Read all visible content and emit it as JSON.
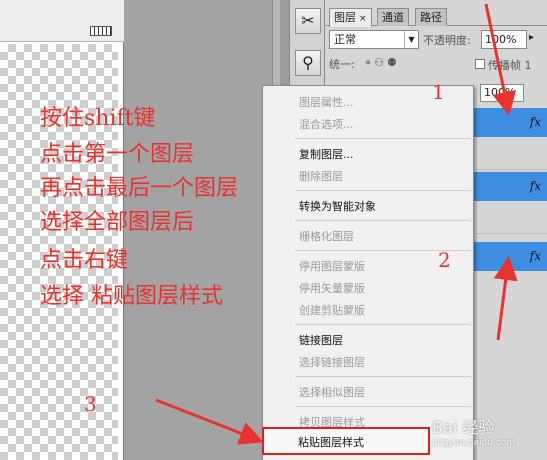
{
  "layers_panel": {
    "tabs": [
      {
        "label": "图层",
        "close": "×"
      },
      {
        "label": "通道"
      },
      {
        "label": "路径"
      }
    ],
    "blend_mode": "正常",
    "opacity_label": "不透明度:",
    "opacity_value": "100%",
    "lock_label": "统一:",
    "propagate_label": "传播帧 1",
    "fill_value": "100%",
    "fx_label": "fx"
  },
  "context_menu": {
    "items": [
      {
        "label": "图层属性...",
        "enabled": false
      },
      {
        "label": "混合选项...",
        "enabled": false
      },
      {
        "label": "复制图层...",
        "enabled": true
      },
      {
        "label": "删除图层",
        "enabled": false
      },
      {
        "label": "转换为智能对象",
        "enabled": true
      },
      {
        "label": "栅格化图层",
        "enabled": false
      },
      {
        "label": "停用图层蒙版",
        "enabled": false
      },
      {
        "label": "停用矢量蒙版",
        "enabled": false
      },
      {
        "label": "创建剪贴蒙版",
        "enabled": false
      },
      {
        "label": "链接图层",
        "enabled": true
      },
      {
        "label": "选择链接图层",
        "enabled": false
      },
      {
        "label": "选择相似图层",
        "enabled": false
      },
      {
        "label": "拷贝图层样式",
        "enabled": false
      },
      {
        "label": "粘贴图层样式",
        "enabled": true
      }
    ]
  },
  "annotation": {
    "lines": [
      "按住shift键",
      "点击第一个图层",
      "再点击最后一个图层",
      "选择全部图层后",
      "点击右键",
      "选择 粘贴图层样式"
    ],
    "numbers": [
      "1",
      "2",
      "3"
    ],
    "color": "#e8322e"
  },
  "watermark": {
    "text": "Bai 经验",
    "sub": "jingyan.baidu.com"
  },
  "colors": {
    "selected_layer": "#3d8de2",
    "highlight_border": "#e02020"
  }
}
